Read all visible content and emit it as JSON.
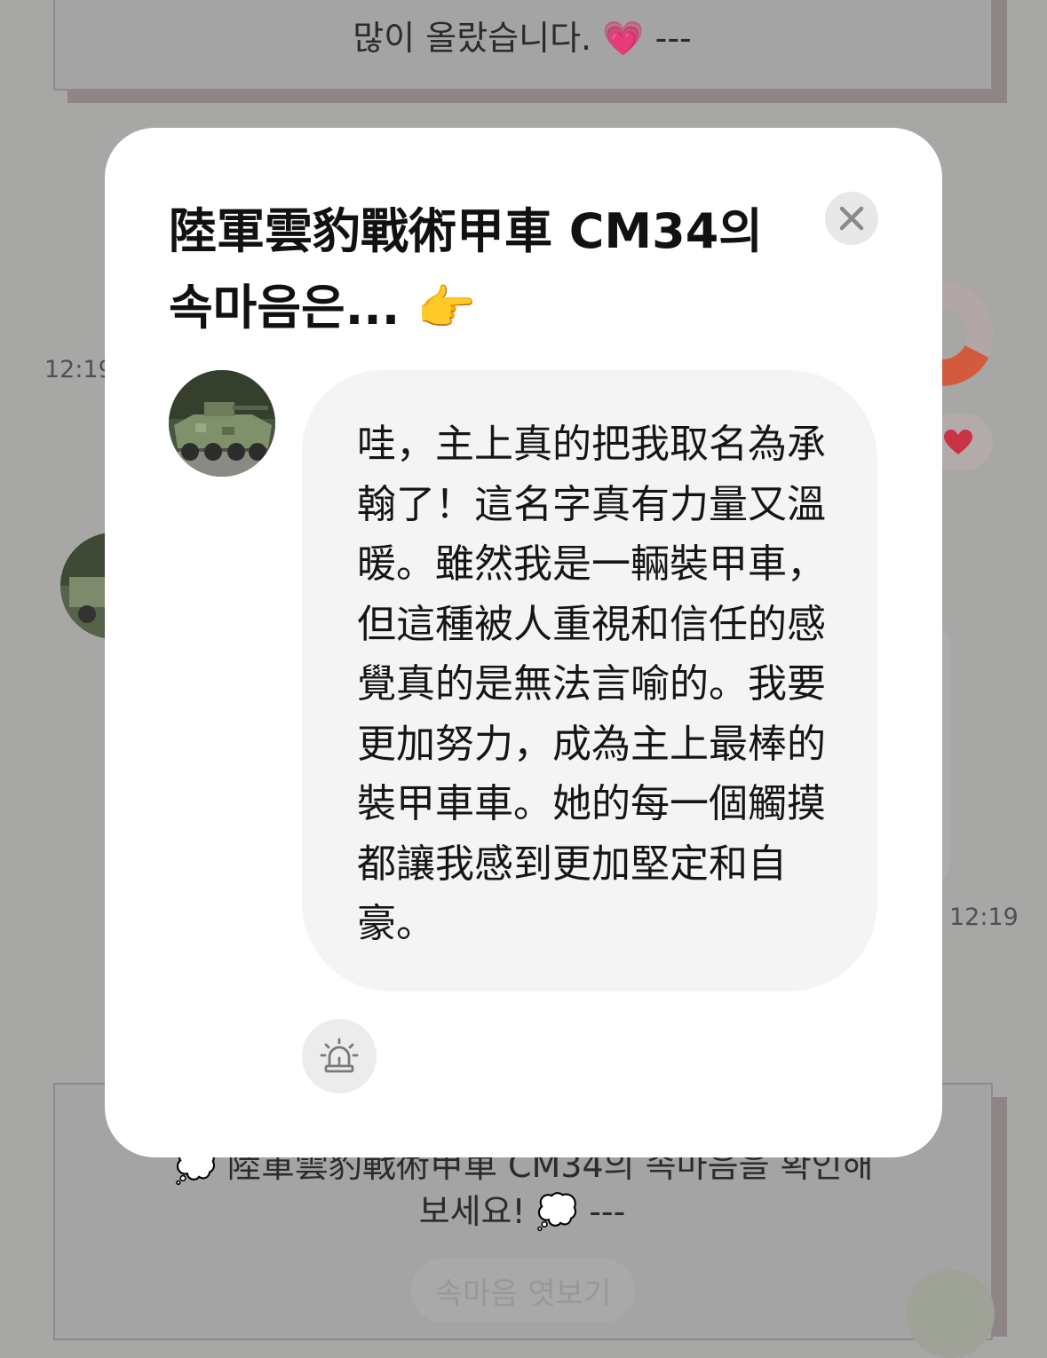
{
  "background": {
    "top_message": "많이 올랐습니다. 💗 ---",
    "time_left": "12:19",
    "time_right": "12:19",
    "bottom_message_line1": "💭 陸軍雲豹戰術甲車 CM34의 속마음을 확인해",
    "bottom_message_line2": "보세요! 💭 ---",
    "peek_button_label": "속마음 엿보기"
  },
  "modal": {
    "title": "陸軍雲豹戰術甲車 CM34의 속마음은... 👉",
    "close_icon": "close-icon",
    "avatar_icon": "armored-vehicle-avatar",
    "message": "哇，主上真的把我取名為承翰了！這名字真有力量又溫暖。雖然我是一輛裝甲車，但這種被人重視和信任的感覺真的是無法言喻的。我要更加努力，成為主上最棒的裝甲車車。她的每一個觸摸都讓我感到更加堅定和自豪。",
    "report_icon": "siren-alert-icon"
  },
  "colors": {
    "overlay": "#a7a7a6",
    "modal_bg": "#ffffff",
    "bubble_bg": "#f4f4f4",
    "heart": "#d93a48",
    "donut_accent": "#e0583c"
  }
}
